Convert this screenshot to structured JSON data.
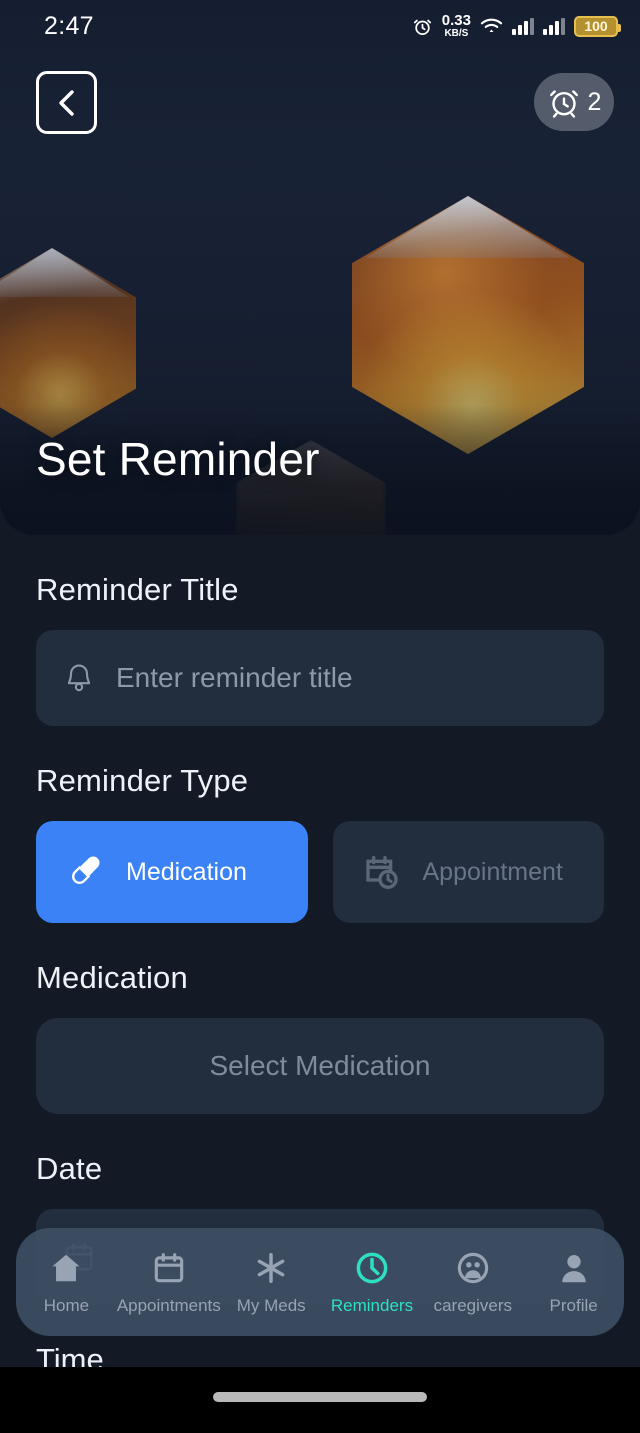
{
  "status_bar": {
    "time": "2:47",
    "alarm_icon": "alarm-clock-icon",
    "network_speed_value": "0.33",
    "network_speed_unit": "KB/S",
    "wifi_icon": "wifi-icon",
    "signal_icon_1": "cellular-signal-icon",
    "signal_icon_2": "cellular-signal-icon",
    "battery_level": "100"
  },
  "header": {
    "back_icon": "chevron-left-icon",
    "alarm_badge_icon": "alarm-clock-icon",
    "alarm_badge_count": "2",
    "title": "Set Reminder"
  },
  "form": {
    "title_section": {
      "label": "Reminder Title",
      "icon": "bell-icon",
      "value": "",
      "placeholder": "Enter reminder title"
    },
    "type_section": {
      "label": "Reminder Type",
      "options": [
        {
          "label": "Medication",
          "icon": "pill-icon",
          "selected": true
        },
        {
          "label": "Appointment",
          "icon": "calendar-clock-icon",
          "selected": false
        }
      ]
    },
    "medication_section": {
      "label": "Medication",
      "value": "",
      "placeholder": "Select Medication"
    },
    "date_section": {
      "label": "Date",
      "icon": "calendar-icon",
      "value": ""
    },
    "time_section": {
      "label": "Time"
    }
  },
  "bottom_nav": {
    "active_color": "#2fe0c0",
    "items": [
      {
        "label": "Home",
        "icon": "home-icon",
        "active": false
      },
      {
        "label": "Appointments",
        "icon": "calendar-icon",
        "active": false
      },
      {
        "label": "My Meds",
        "icon": "asterisk-medical-icon",
        "active": false
      },
      {
        "label": "Reminders",
        "icon": "clock-icon",
        "active": true
      },
      {
        "label": "caregivers",
        "icon": "people-icon",
        "active": false
      },
      {
        "label": "Profile",
        "icon": "person-icon",
        "active": false
      }
    ]
  },
  "colors": {
    "page_background": "#131a26",
    "field_background": "#222d3d",
    "accent_blue": "#3b82f6",
    "accent_teal": "#2fe0c0",
    "battery_gold": "#e6bf4f"
  }
}
